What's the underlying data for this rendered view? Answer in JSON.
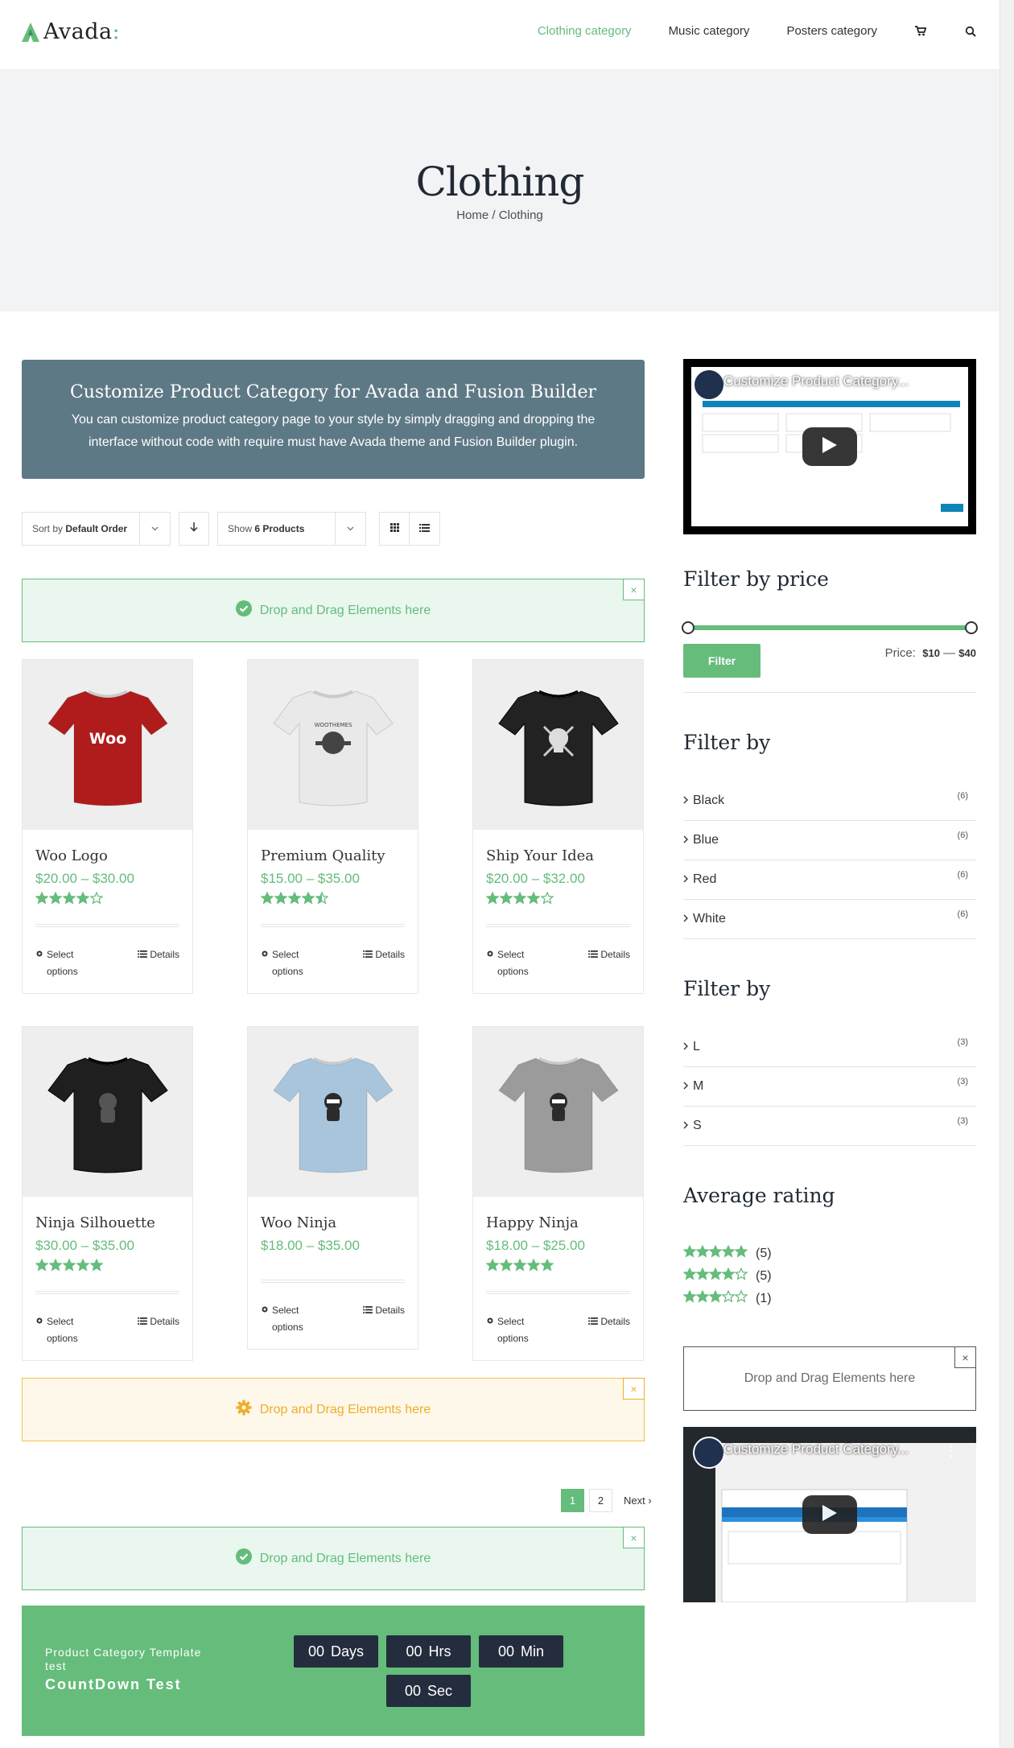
{
  "header": {
    "logo_text": "Avada",
    "logo_colon": ":",
    "nav": [
      "Clothing category",
      "Music category",
      "Posters category"
    ],
    "active_nav": "Clothing category"
  },
  "hero": {
    "title": "Clothing",
    "breadcrumb": "Home / Clothing"
  },
  "banner": {
    "title": "Customize Product Category for Avada and Fusion Builder",
    "text": "You can customize product category page to your style by simply dragging and dropping the interface without code with require must have Avada theme and Fusion Builder plugin."
  },
  "toolbar": {
    "sort_prefix": "Sort by",
    "sort_value": "Default Order",
    "show_prefix": "Show",
    "show_value": "6 Products"
  },
  "dropzone_label": "Drop and Drag Elements here",
  "products": [
    {
      "title": "Woo Logo",
      "price": "$20.00 – $30.00",
      "rating": 4,
      "shirt": "#b01c1c",
      "print": "woo"
    },
    {
      "title": "Premium Quality",
      "price": "$15.00 – $35.00",
      "rating": 4.5,
      "shirt": "#e9e9e9",
      "print": "premium"
    },
    {
      "title": "Ship Your Idea",
      "price": "$20.00 – $32.00",
      "rating": 4,
      "shirt": "#222222",
      "print": "skull"
    },
    {
      "title": "Ninja Silhouette",
      "price": "$30.00 – $35.00",
      "rating": 5,
      "shirt": "#1f1f1f",
      "print": "ninja-dark"
    },
    {
      "title": "Woo Ninja",
      "price": "$18.00 – $35.00",
      "rating": 0,
      "shirt": "#a9c5dc",
      "print": "ninja"
    },
    {
      "title": "Happy Ninja",
      "price": "$18.00 – $25.00",
      "rating": 5,
      "shirt": "#9b9b9b",
      "print": "ninja"
    }
  ],
  "card_actions": {
    "select": "Select options",
    "details": "Details"
  },
  "pagination": {
    "pages": [
      "1",
      "2"
    ],
    "current": "1",
    "next": "Next"
  },
  "countdown": {
    "title": "Product Category Template test",
    "subtitle": "CountDown Test",
    "units": [
      {
        "value": "00",
        "label": "Days"
      },
      {
        "value": "00",
        "label": "Hrs"
      },
      {
        "value": "00",
        "label": "Min"
      },
      {
        "value": "00",
        "label": "Sec"
      }
    ]
  },
  "sidebar": {
    "video_title": "Customize Product Category...",
    "video_title_full": "Customize Product Category...",
    "price_filter": {
      "title": "Filter by price",
      "button": "Filter",
      "price_label": "Price:",
      "min": "$10",
      "max": "$40",
      "separator": "—"
    },
    "color_filter": {
      "title": "Filter by",
      "items": [
        {
          "label": "Black",
          "count": "(6)"
        },
        {
          "label": "Blue",
          "count": "(6)"
        },
        {
          "label": "Red",
          "count": "(6)"
        },
        {
          "label": "White",
          "count": "(6)"
        }
      ]
    },
    "size_filter": {
      "title": "Filter by",
      "items": [
        {
          "label": "L",
          "count": "(3)"
        },
        {
          "label": "M",
          "count": "(3)"
        },
        {
          "label": "S",
          "count": "(3)"
        }
      ]
    },
    "rating_filter": {
      "title": "Average rating",
      "items": [
        {
          "stars": 5,
          "count": "(5)"
        },
        {
          "stars": 4,
          "count": "(5)"
        },
        {
          "stars": 3,
          "count": "(1)"
        }
      ]
    }
  },
  "colors": {
    "accent": "#65bc7b",
    "banner": "#5e7986",
    "dark": "#242d3d",
    "warn": "#f0ad2c"
  },
  "icons": [
    "cart-icon",
    "search-icon",
    "chevron-down-icon",
    "arrow-down-icon",
    "grid-icon",
    "list-icon",
    "check-circle-icon",
    "gear-icon",
    "close-icon",
    "play-icon"
  ]
}
